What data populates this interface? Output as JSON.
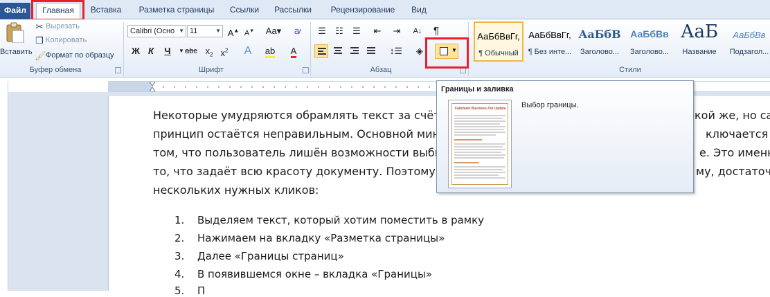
{
  "tabs": {
    "file": "Файл",
    "items": [
      "Главная",
      "Вставка",
      "Разметка страницы",
      "Ссылки",
      "Рассылки",
      "Рецензирование",
      "Вид"
    ]
  },
  "clipboard": {
    "paste": "Вставить",
    "cut": "Вырезать",
    "copy": "Копировать",
    "format_painter": "Формат по образцу",
    "label": "Буфер обмена"
  },
  "font": {
    "name": "Calibri (Осно",
    "size": "11",
    "label": "Шрифт"
  },
  "paragraph": {
    "label": "Абзац"
  },
  "styles": {
    "label": "Стили",
    "items": [
      {
        "sample": "АаБбВвГг,",
        "name": "¶ Обычный"
      },
      {
        "sample": "АаБбВвГг,",
        "name": "¶ Без инте..."
      },
      {
        "sample": "АаБбВ",
        "name": "Заголово..."
      },
      {
        "sample": "АаБбВв",
        "name": "Заголово..."
      },
      {
        "sample": "АаБ",
        "name": "Название"
      },
      {
        "sample": "АаБбВв",
        "name": "Подзагол..."
      }
    ]
  },
  "tooltip": {
    "title": "Границы и заливка",
    "description": "Выбор границы.",
    "thumbnail_heading": "Fabrikam Business Put Update"
  },
  "document": {
    "lines": [
      "Некоторые умудряются обрамлять текст за счёт та",
      "принцип остаётся неправильным. Основной мину",
      "том, что пользователь лишён возможности выбир",
      "то, что задаёт всю красоту документу. Поэтому, чт",
      "нескольких нужных кликов:"
    ],
    "lines_right": [
      "кой же, но сам",
      "ключается в",
      "е. Это именно",
      "му, достаточн",
      ""
    ],
    "list": [
      {
        "num": "1.",
        "text": "Выделяем текст, который хотим поместить в рамку"
      },
      {
        "num": "2.",
        "text": "Нажимаем на вкладку «Разметка страницы»"
      },
      {
        "num": "3.",
        "text": "Далее «Границы страниц»"
      },
      {
        "num": "4.",
        "text": "В появившемся окне – вкладка «Границы»"
      },
      {
        "num": "5.",
        "text": "П"
      }
    ]
  },
  "colors": {
    "accent_red": "#e8202a",
    "file_tab": "#2b5797",
    "highlight": "#fde49a"
  }
}
